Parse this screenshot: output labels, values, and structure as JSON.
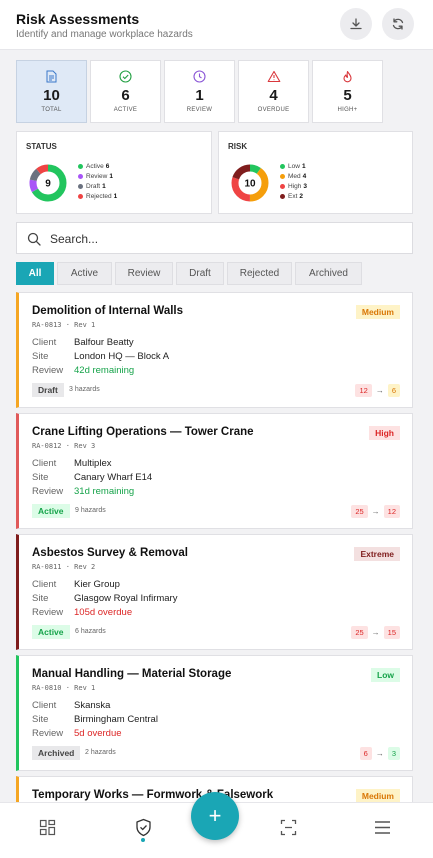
{
  "header": {
    "title": "Risk Assessments",
    "subtitle": "Identify and manage workplace hazards",
    "download_icon": "download-icon",
    "refresh_icon": "refresh-icon"
  },
  "stats": [
    {
      "value": "10",
      "label": "TOTAL",
      "icon": "document-icon",
      "color": "#3a78c9"
    },
    {
      "value": "6",
      "label": "ACTIVE",
      "icon": "check-circle-icon",
      "color": "#22a043"
    },
    {
      "value": "1",
      "label": "REVIEW",
      "icon": "clock-icon",
      "color": "#8a55d6"
    },
    {
      "value": "4",
      "label": "OVERDUE",
      "icon": "warning-icon",
      "color": "#d9373c"
    },
    {
      "value": "5",
      "label": "HIGH+",
      "icon": "flame-icon",
      "color": "#d9373c"
    }
  ],
  "status_card": {
    "title": "STATUS",
    "total": "9",
    "items": [
      {
        "label": "Active",
        "count": "6",
        "color": "#22c55e"
      },
      {
        "label": "Review",
        "count": "1",
        "color": "#a855f7"
      },
      {
        "label": "Draft",
        "count": "1",
        "color": "#6b7280"
      },
      {
        "label": "Rejected",
        "count": "1",
        "color": "#ef4444"
      }
    ]
  },
  "risk_card": {
    "title": "RISK",
    "total": "10",
    "items": [
      {
        "label": "Low",
        "count": "1",
        "color": "#22c55e"
      },
      {
        "label": "Med",
        "count": "4",
        "color": "#f59e0b"
      },
      {
        "label": "High",
        "count": "3",
        "color": "#ef4444"
      },
      {
        "label": "Ext",
        "count": "2",
        "color": "#7f1d1d"
      }
    ]
  },
  "search": {
    "placeholder": "Search..."
  },
  "tabs": [
    "All",
    "Active",
    "Review",
    "Draft",
    "Rejected",
    "Archived"
  ],
  "assessments": [
    {
      "title": "Demolition of Internal Walls",
      "code": "RA-0813 · Rev 1",
      "level": "Medium",
      "level_fg": "#d97706",
      "level_bg": "#fef3c7",
      "accent": "#f5a623",
      "client": "Balfour Beatty",
      "site": "London HQ — Block A",
      "review": "42d remaining",
      "review_color": "#16a34a",
      "status": "Draft",
      "status_fg": "#444",
      "status_bg": "#e8e8ea",
      "hazards": "3 hazards",
      "score_from": "12",
      "from_fg": "#dc2626",
      "from_bg": "#fde2e2",
      "score_to": "6",
      "to_fg": "#d97706",
      "to_bg": "#fef3c7"
    },
    {
      "title": "Crane Lifting Operations — Tower Crane",
      "code": "RA-0812 · Rev 3",
      "level": "High",
      "level_fg": "#dc2626",
      "level_bg": "#fde2e2",
      "accent": "#e05a5a",
      "client": "Multiplex",
      "site": "Canary Wharf E14",
      "review": "31d remaining",
      "review_color": "#16a34a",
      "status": "Active",
      "status_fg": "#16a34a",
      "status_bg": "#dcfce7",
      "hazards": "9 hazards",
      "score_from": "25",
      "from_fg": "#dc2626",
      "from_bg": "#fde2e2",
      "score_to": "12",
      "to_fg": "#dc2626",
      "to_bg": "#fde2e2"
    },
    {
      "title": "Asbestos Survey & Removal",
      "code": "RA-0811 · Rev 2",
      "level": "Extreme",
      "level_fg": "#7f1d1d",
      "level_bg": "#f3e0e0",
      "accent": "#7f1d1d",
      "client": "Kier Group",
      "site": "Glasgow Royal Infirmary",
      "review": "105d overdue",
      "review_color": "#dc2626",
      "status": "Active",
      "status_fg": "#16a34a",
      "status_bg": "#dcfce7",
      "hazards": "6 hazards",
      "score_from": "25",
      "from_fg": "#dc2626",
      "from_bg": "#fde2e2",
      "score_to": "15",
      "to_fg": "#dc2626",
      "to_bg": "#fde2e2"
    },
    {
      "title": "Manual Handling — Material Storage",
      "code": "RA-0810 · Rev 1",
      "level": "Low",
      "level_fg": "#16a34a",
      "level_bg": "#dcfce7",
      "accent": "#22c55e",
      "client": "Skanska",
      "site": "Birmingham Central",
      "review": "5d overdue",
      "review_color": "#dc2626",
      "status": "Archived",
      "status_fg": "#444",
      "status_bg": "#e8e8ea",
      "hazards": "2 hazards",
      "score_from": "6",
      "from_fg": "#dc2626",
      "from_bg": "#fde2e2",
      "score_to": "3",
      "to_fg": "#16a34a",
      "to_bg": "#dcfce7"
    },
    {
      "title": "Temporary Works — Formwork & Falsework",
      "code": "",
      "level": "Medium",
      "level_fg": "#d97706",
      "level_bg": "#fef3c7",
      "accent": "#f5a623",
      "client": "",
      "site": "",
      "review": "",
      "review_color": "#16a34a",
      "status": "",
      "status_fg": "#444",
      "status_bg": "#e8e8ea",
      "hazards": "",
      "score_from": "",
      "from_fg": "#dc2626",
      "from_bg": "#fde2e2",
      "score_to": "",
      "to_fg": "#d97706",
      "to_bg": "#fef3c7"
    }
  ],
  "row_labels": {
    "client": "Client",
    "site": "Site",
    "review": "Review"
  },
  "nav": {
    "dashboard_icon": "dashboard-icon",
    "shield_icon": "shield-check-icon",
    "add_label": "+",
    "scan_icon": "scan-icon",
    "menu_icon": "menu-icon"
  }
}
